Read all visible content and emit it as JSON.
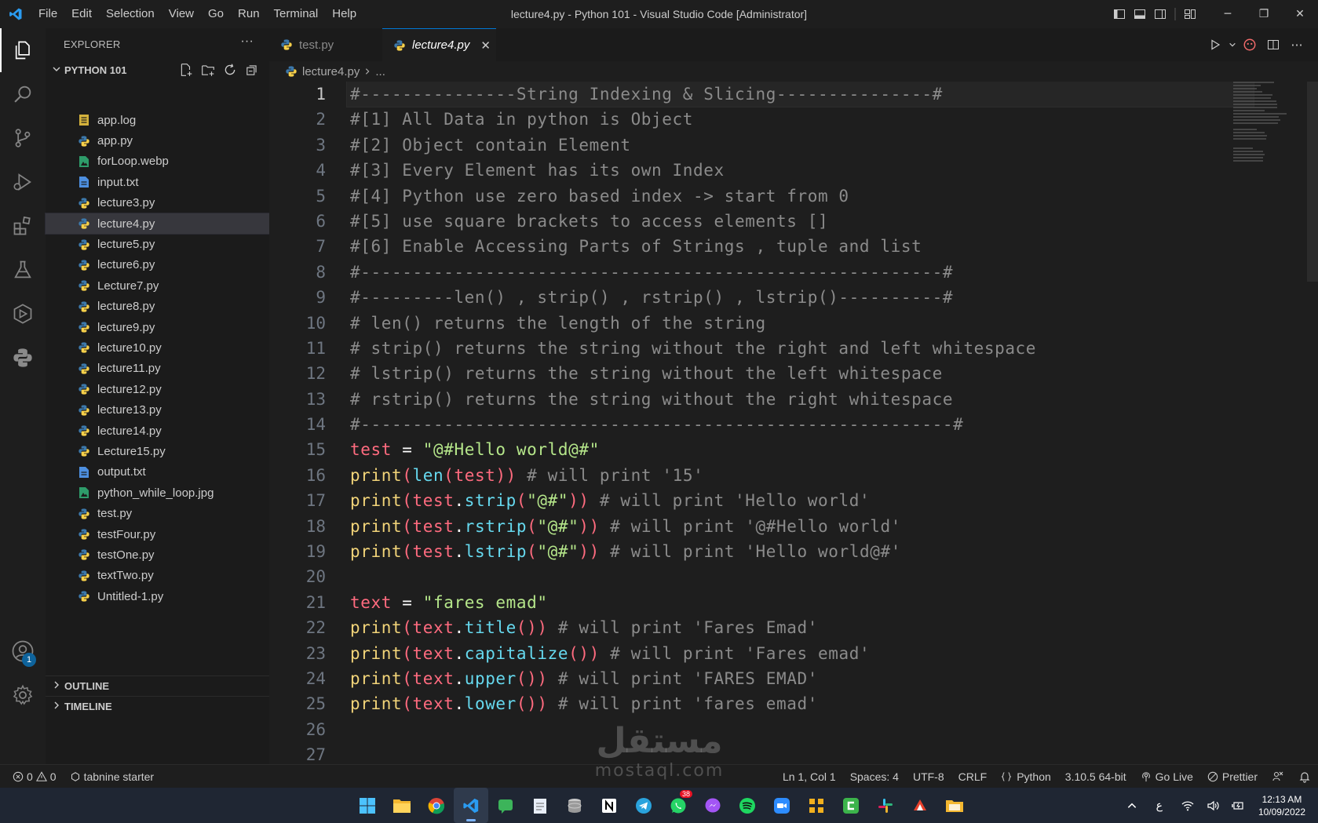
{
  "window": {
    "title": "lecture4.py - Python 101 - Visual Studio Code [Administrator]",
    "menu": [
      "File",
      "Edit",
      "Selection",
      "View",
      "Go",
      "Run",
      "Terminal",
      "Help"
    ]
  },
  "activity_bar": {
    "items": [
      "explorer-icon",
      "search-icon",
      "source-control-icon",
      "run-debug-icon",
      "extensions-icon",
      "testing-icon",
      "remote-icon",
      "python-icon"
    ],
    "accounts_badge": "1"
  },
  "sidebar": {
    "title": "EXPLORER",
    "more": "···",
    "folder": "PYTHON 101",
    "files": [
      {
        "name": "app.log",
        "type": "log"
      },
      {
        "name": "app.py",
        "type": "py"
      },
      {
        "name": "forLoop.webp",
        "type": "img"
      },
      {
        "name": "input.txt",
        "type": "txt"
      },
      {
        "name": "lecture3.py",
        "type": "py"
      },
      {
        "name": "lecture4.py",
        "type": "py"
      },
      {
        "name": "lecture5.py",
        "type": "py"
      },
      {
        "name": "lecture6.py",
        "type": "py"
      },
      {
        "name": "Lecture7.py",
        "type": "py"
      },
      {
        "name": "lecture8.py",
        "type": "py"
      },
      {
        "name": "lecture9.py",
        "type": "py"
      },
      {
        "name": "lecture10.py",
        "type": "py"
      },
      {
        "name": "lecture11.py",
        "type": "py"
      },
      {
        "name": "lecture12.py",
        "type": "py"
      },
      {
        "name": "lecture13.py",
        "type": "py"
      },
      {
        "name": "lecture14.py",
        "type": "py"
      },
      {
        "name": "Lecture15.py",
        "type": "py"
      },
      {
        "name": "output.txt",
        "type": "txt"
      },
      {
        "name": "python_while_loop.jpg",
        "type": "img"
      },
      {
        "name": "test.py",
        "type": "py"
      },
      {
        "name": "testFour.py",
        "type": "py"
      },
      {
        "name": "testOne.py",
        "type": "py"
      },
      {
        "name": "textTwo.py",
        "type": "py"
      },
      {
        "name": "Untitled-1.py",
        "type": "py"
      }
    ],
    "selected_file": "lecture4.py",
    "outline": "OUTLINE",
    "timeline": "TIMELINE"
  },
  "tabs": [
    {
      "label": "test.py",
      "active": false
    },
    {
      "label": "lecture4.py",
      "active": true,
      "close": "✕"
    }
  ],
  "breadcrumb": {
    "file": "lecture4.py",
    "rest": "..."
  },
  "editor": {
    "current_line": 1,
    "lines": [
      [
        [
          "cm",
          "#---------------String Indexing & Slicing---------------#"
        ]
      ],
      [
        [
          "cm",
          "#[1] All Data in python is Object"
        ]
      ],
      [
        [
          "cm",
          "#[2] Object contain Element"
        ]
      ],
      [
        [
          "cm",
          "#[3] Every Element has its own Index"
        ]
      ],
      [
        [
          "cm",
          "#[4] Python use zero based index -> start from 0"
        ]
      ],
      [
        [
          "cm",
          "#[5] use square brackets to access elements []"
        ]
      ],
      [
        [
          "cm",
          "#[6] Enable Accessing Parts of Strings , tuple and list"
        ]
      ],
      [
        [
          "cm",
          "#--------------------------------------------------------#"
        ]
      ],
      [
        [
          "cm",
          "#---------len() , strip() , rstrip() , lstrip()----------#"
        ]
      ],
      [
        [
          "cm",
          "# len() returns the length of the string"
        ]
      ],
      [
        [
          "cm",
          "# strip() returns the string without the right and left whitespace"
        ]
      ],
      [
        [
          "cm",
          "# lstrip() returns the string without the left whitespace"
        ]
      ],
      [
        [
          "cm",
          "# rstrip() returns the string without the right whitespace"
        ]
      ],
      [
        [
          "cm",
          "#---------------------------------------------------------#"
        ]
      ],
      [
        [
          "var",
          "test"
        ],
        [
          "op",
          " = "
        ],
        [
          "str",
          "\"@#Hello world@#\""
        ]
      ],
      [
        [
          "kw",
          "print"
        ],
        [
          "pn",
          "("
        ],
        [
          "fn",
          "len"
        ],
        [
          "pn",
          "("
        ],
        [
          "var",
          "test"
        ],
        [
          "pn",
          "))"
        ],
        [
          "cm",
          " # will print '15'"
        ]
      ],
      [
        [
          "kw",
          "print"
        ],
        [
          "pn",
          "("
        ],
        [
          "var",
          "test"
        ],
        [
          "op",
          "."
        ],
        [
          "meth",
          "strip"
        ],
        [
          "pn",
          "("
        ],
        [
          "str",
          "\"@#\""
        ],
        [
          "pn",
          "))"
        ],
        [
          "cm",
          " # will print 'Hello world'"
        ]
      ],
      [
        [
          "kw",
          "print"
        ],
        [
          "pn",
          "("
        ],
        [
          "var",
          "test"
        ],
        [
          "op",
          "."
        ],
        [
          "meth",
          "rstrip"
        ],
        [
          "pn",
          "("
        ],
        [
          "str",
          "\"@#\""
        ],
        [
          "pn",
          "))"
        ],
        [
          "cm",
          " # will print '@#Hello world'"
        ]
      ],
      [
        [
          "kw",
          "print"
        ],
        [
          "pn",
          "("
        ],
        [
          "var",
          "test"
        ],
        [
          "op",
          "."
        ],
        [
          "meth",
          "lstrip"
        ],
        [
          "pn",
          "("
        ],
        [
          "str",
          "\"@#\""
        ],
        [
          "pn",
          "))"
        ],
        [
          "cm",
          " # will print 'Hello world@#'"
        ]
      ],
      [],
      [
        [
          "var",
          "text"
        ],
        [
          "op",
          " = "
        ],
        [
          "str",
          "\"fares emad\""
        ]
      ],
      [
        [
          "kw",
          "print"
        ],
        [
          "pn",
          "("
        ],
        [
          "var",
          "text"
        ],
        [
          "op",
          "."
        ],
        [
          "meth",
          "title"
        ],
        [
          "pn",
          "())"
        ],
        [
          "cm",
          " # will print 'Fares Emad'"
        ]
      ],
      [
        [
          "kw",
          "print"
        ],
        [
          "pn",
          "("
        ],
        [
          "var",
          "text"
        ],
        [
          "op",
          "."
        ],
        [
          "meth",
          "capitalize"
        ],
        [
          "pn",
          "())"
        ],
        [
          "cm",
          " # will print 'Fares emad'"
        ]
      ],
      [
        [
          "kw",
          "print"
        ],
        [
          "pn",
          "("
        ],
        [
          "var",
          "text"
        ],
        [
          "op",
          "."
        ],
        [
          "meth",
          "upper"
        ],
        [
          "pn",
          "())"
        ],
        [
          "cm",
          " # will print 'FARES EMAD'"
        ]
      ],
      [
        [
          "kw",
          "print"
        ],
        [
          "pn",
          "("
        ],
        [
          "var",
          "text"
        ],
        [
          "op",
          "."
        ],
        [
          "meth",
          "lower"
        ],
        [
          "pn",
          "())"
        ],
        [
          "cm",
          " # will print 'fares emad'"
        ]
      ],
      [],
      []
    ]
  },
  "status_bar": {
    "errors": "0",
    "warnings": "0",
    "tabnine": "tabnine starter",
    "position": "Ln 1, Col 1",
    "spaces": "Spaces: 4",
    "encoding": "UTF-8",
    "eol": "CRLF",
    "language": "Python",
    "interpreter": "3.10.5 64-bit",
    "golive": "Go Live",
    "prettier": "Prettier"
  },
  "taskbar": {
    "apps": [
      "windows-start-icon",
      "file-explorer-icon",
      "chrome-icon",
      "vscode-icon",
      "app-green-icon",
      "notepad-icon",
      "database-icon",
      "notion-icon",
      "telegram-icon",
      "whatsapp-icon",
      "messenger-icon",
      "spotify-icon",
      "zoom-icon",
      "app-yellow-icon",
      "camtasia-icon",
      "slack-icon",
      "app-red-icon",
      "folder-icon"
    ],
    "whatsapp_badge": "38",
    "lang": "ع",
    "time": "12:13 AM",
    "date": "10/09/2022"
  },
  "watermark": {
    "arabic": "مستقل",
    "latin": "mostaql.com"
  }
}
